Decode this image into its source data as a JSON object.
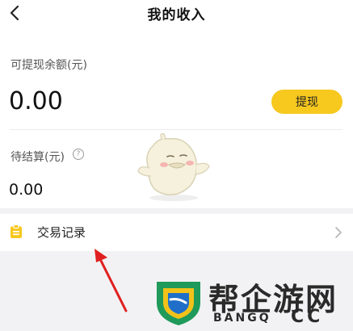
{
  "header": {
    "title": "我的收入",
    "back_icon": "chevron-left-icon"
  },
  "withdrawable": {
    "label": "可提现余额(元)",
    "amount": "0.00",
    "button_label": "提现"
  },
  "pending": {
    "label": "待结算(元)",
    "help_icon": "?",
    "amount": "0.00"
  },
  "transactions": {
    "label": "交易记录",
    "icon": "clipboard-icon",
    "chevron": "chevron-right-icon"
  },
  "watermark": {
    "title": "帮企游网",
    "subtitle": "BANGQ",
    "cc": "CC"
  },
  "colors": {
    "accent": "#f7c81e",
    "background": "#f2f2f4",
    "arrow": "#e02020"
  }
}
